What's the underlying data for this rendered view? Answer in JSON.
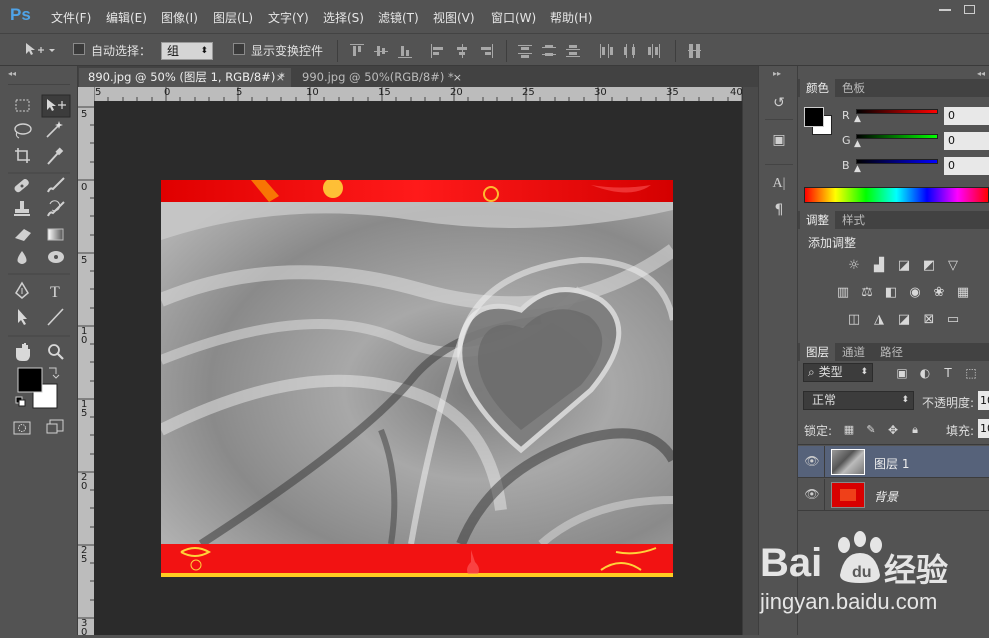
{
  "app": {
    "logo": "Ps"
  },
  "menu": [
    "文件(F)",
    "编辑(E)",
    "图像(I)",
    "图层(L)",
    "文字(Y)",
    "选择(S)",
    "滤镜(T)",
    "视图(V)",
    "窗口(W)",
    "帮助(H)"
  ],
  "options": {
    "auto_select_label": "自动选择：",
    "auto_select_value": "组",
    "show_transform_label": "显示变换控件"
  },
  "tabs": [
    {
      "label": "890.jpg @ 50% (图层 1, RGB/8#) *",
      "close": "×",
      "active": true
    },
    {
      "label": "990.jpg @ 50%(RGB/8#) *",
      "close": "×",
      "active": false
    }
  ],
  "ruler": {
    "top_ticks": [
      "5",
      "0",
      "5",
      "10",
      "15",
      "20",
      "25",
      "30",
      "35",
      "40"
    ],
    "left_ticks": [
      "5",
      "0",
      "5",
      "1 0",
      "1 5",
      "2 0",
      "2 5",
      "3 0"
    ]
  },
  "color_panel": {
    "tabs": [
      "颜色",
      "色板"
    ],
    "channels": [
      {
        "label": "R",
        "value": "0",
        "color": "#e01818"
      },
      {
        "label": "G",
        "value": "0",
        "color": "#18c818"
      },
      {
        "label": "B",
        "value": "0",
        "color": "#1818e0"
      }
    ]
  },
  "adjust_panel": {
    "tabs": [
      "调整",
      "样式"
    ],
    "title": "添加调整"
  },
  "layers_panel": {
    "tabs": [
      "图层",
      "通道",
      "路径"
    ],
    "filter_label": "类型",
    "blend_mode": "正常",
    "opacity_label": "不透明度:",
    "opacity_value": "10",
    "lock_label": "锁定:",
    "fill_label": "填充:",
    "fill_value": "10",
    "layers": [
      {
        "name": "图层 1",
        "selected": true
      },
      {
        "name": "背景",
        "selected": false
      }
    ]
  },
  "watermark": {
    "brand_a": "Bai",
    "brand_b": "经验",
    "url": "jingyan.baidu.com"
  }
}
